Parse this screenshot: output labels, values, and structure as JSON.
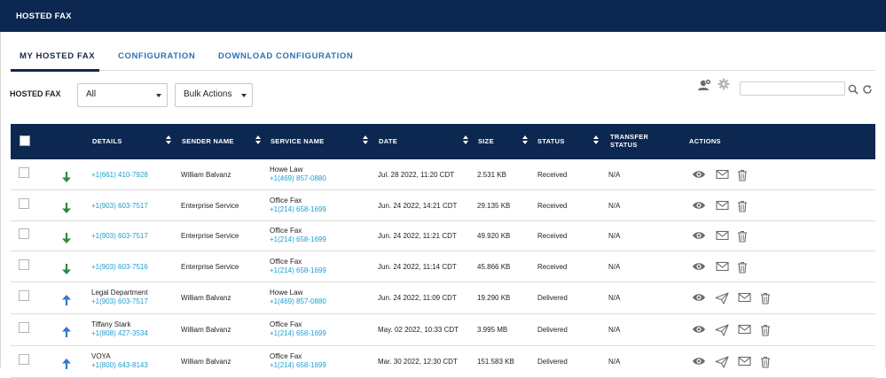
{
  "header": {
    "title": "HOSTED FAX"
  },
  "tabs": [
    {
      "label": "MY HOSTED FAX",
      "active": true
    },
    {
      "label": "CONFIGURATION",
      "active": false
    },
    {
      "label": "DOWNLOAD CONFIGURATION",
      "active": false
    }
  ],
  "filters": {
    "label": "HOSTED FAX",
    "type_select": "All",
    "bulk_select": "Bulk Actions",
    "search_value": ""
  },
  "table": {
    "columns": [
      "DETAILS",
      "SENDER NAME",
      "SERVICE NAME",
      "DATE",
      "SIZE",
      "STATUS",
      "TRANSFER",
      "STATUS",
      "ACTIONS"
    ],
    "rows": [
      {
        "direction": "incoming",
        "detail_name": "",
        "detail_number": "+1(661) 410-7928",
        "sender": "William Balvanz",
        "service_name": "Howe Law",
        "service_number": "+1(469) 857-0880",
        "date": "Jul. 28 2022, 11:20 CDT",
        "size": "2.531 KB",
        "status": "Received",
        "transfer": "N/A"
      },
      {
        "direction": "incoming",
        "detail_name": "",
        "detail_number": "+1(903) 603-7517",
        "sender": "Enterprise Service",
        "service_name": "Office Fax",
        "service_number": "+1(214) 658-1699",
        "date": "Jun. 24 2022, 14:21 CDT",
        "size": "29.135 KB",
        "status": "Received",
        "transfer": "N/A"
      },
      {
        "direction": "incoming",
        "detail_name": "",
        "detail_number": "+1(903) 603-7517",
        "sender": "Enterprise Service",
        "service_name": "Office Fax",
        "service_number": "+1(214) 658-1699",
        "date": "Jun. 24 2022, 11:21 CDT",
        "size": "49.920 KB",
        "status": "Received",
        "transfer": "N/A"
      },
      {
        "direction": "incoming",
        "detail_name": "",
        "detail_number": "+1(903) 603-7516",
        "sender": "Enterprise Service",
        "service_name": "Office Fax",
        "service_number": "+1(214) 658-1699",
        "date": "Jun. 24 2022, 11:14 CDT",
        "size": "45.866 KB",
        "status": "Received",
        "transfer": "N/A"
      },
      {
        "direction": "outgoing",
        "detail_name": "Legal Department",
        "detail_number": "+1(903) 603-7517",
        "sender": "William Balvanz",
        "service_name": "Howe Law",
        "service_number": "+1(469) 857-0880",
        "date": "Jun. 24 2022, 11:09 CDT",
        "size": "19.290 KB",
        "status": "Delivered",
        "transfer": "N/A"
      },
      {
        "direction": "outgoing",
        "detail_name": "Tiffany Stark",
        "detail_number": "+1(808) 427-3534",
        "sender": "William Balvanz",
        "service_name": "Office Fax",
        "service_number": "+1(214) 658-1699",
        "date": "May. 02 2022, 10:33 CDT",
        "size": "3.995 MB",
        "status": "Delivered",
        "transfer": "N/A"
      },
      {
        "direction": "outgoing",
        "detail_name": "VOYA",
        "detail_number": "+1(800) 643-8143",
        "sender": "William Balvanz",
        "service_name": "Office Fax",
        "service_number": "+1(214) 658-1699",
        "date": "Mar. 30 2022, 12:30 CDT",
        "size": "151.583 KB",
        "status": "Delivered",
        "transfer": "N/A"
      }
    ]
  },
  "colors": {
    "navy": "#0c2850",
    "link_blue": "#2b72b5",
    "number_cyan": "#1a9fcf",
    "incoming_green": "#2e8b3a",
    "outgoing_blue": "#3478c4",
    "icon_gray": "#6b6b6b"
  },
  "icons": [
    "incoming-arrow-icon",
    "outgoing-arrow-icon",
    "view-icon",
    "email-icon",
    "resend-icon",
    "delete-icon",
    "fax-user-icon",
    "gear-icon",
    "search-icon",
    "refresh-icon"
  ]
}
